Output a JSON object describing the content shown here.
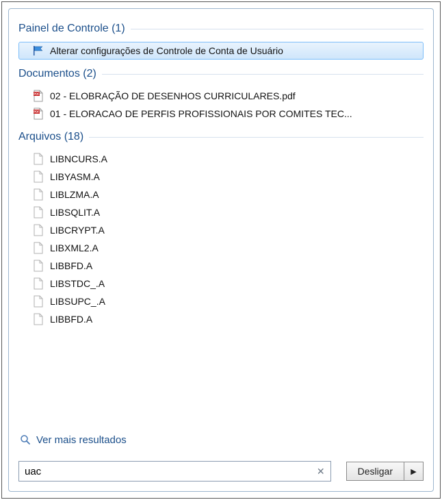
{
  "sections": [
    {
      "title": "Painel de Controle (1)",
      "items": [
        {
          "label": "Alterar configurações de Controle de Conta de Usuário",
          "iconName": "flag-icon",
          "selected": true,
          "iconType": "flag"
        }
      ]
    },
    {
      "title": "Documentos (2)",
      "items": [
        {
          "label": "02 - ELOBRAÇÃO DE DESENHOS CURRICULARES.pdf",
          "iconName": "pdf-icon",
          "iconType": "pdf"
        },
        {
          "label": "01 - ELORACAO DE PERFIS PROFISSIONAIS POR COMITES TEC...",
          "iconName": "pdf-icon",
          "iconType": "pdf"
        }
      ]
    },
    {
      "title": "Arquivos (18)",
      "items": [
        {
          "label": "LIBNCURS.A",
          "iconName": "file-icon",
          "iconType": "file"
        },
        {
          "label": "LIBYASM.A",
          "iconName": "file-icon",
          "iconType": "file"
        },
        {
          "label": "LIBLZMA.A",
          "iconName": "file-icon",
          "iconType": "file"
        },
        {
          "label": "LIBSQLIT.A",
          "iconName": "file-icon",
          "iconType": "file"
        },
        {
          "label": "LIBCRYPT.A",
          "iconName": "file-icon",
          "iconType": "file"
        },
        {
          "label": "LIBXML2.A",
          "iconName": "file-icon",
          "iconType": "file"
        },
        {
          "label": "LIBBFD.A",
          "iconName": "file-icon",
          "iconType": "file"
        },
        {
          "label": "LIBSTDC_.A",
          "iconName": "file-icon",
          "iconType": "file"
        },
        {
          "label": "LIBSUPC_.A",
          "iconName": "file-icon",
          "iconType": "file"
        },
        {
          "label": "LIBBFD.A",
          "iconName": "file-icon",
          "iconType": "file"
        }
      ]
    }
  ],
  "more_results": {
    "label": "Ver mais resultados",
    "iconName": "search-icon"
  },
  "search": {
    "value": "uac",
    "clearIconName": "clear-icon"
  },
  "shutdown": {
    "label": "Desligar",
    "arrowIconName": "chevron-right-icon"
  }
}
